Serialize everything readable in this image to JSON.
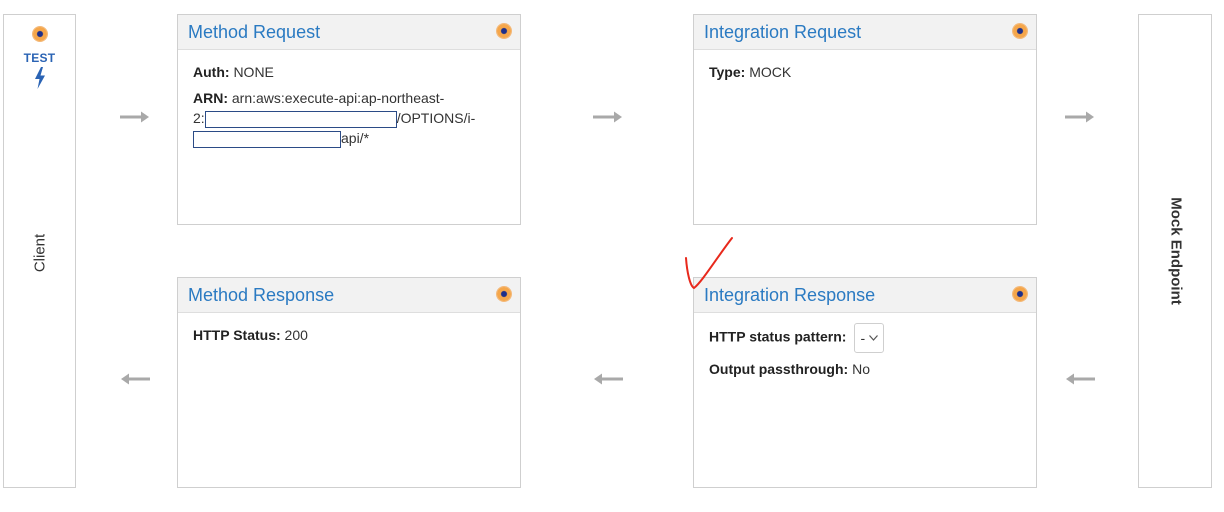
{
  "client": {
    "test_label": "TEST",
    "label": "Client"
  },
  "endpoint": {
    "label": "Mock Endpoint"
  },
  "method_request": {
    "title": "Method Request",
    "auth_label": "Auth:",
    "auth_value": "NONE",
    "arn_label": "ARN:",
    "arn_part1": "arn:aws:execute-api:ap-northeast-",
    "arn_part2": "2:",
    "arn_part3": "/OPTIONS/i-",
    "arn_part4": "api/*"
  },
  "integration_request": {
    "title": "Integration Request",
    "type_label": "Type:",
    "type_value": "MOCK"
  },
  "method_response": {
    "title": "Method Response",
    "status_label": "HTTP Status:",
    "status_value": "200"
  },
  "integration_response": {
    "title": "Integration Response",
    "pattern_label": "HTTP status pattern:",
    "pattern_value": "-",
    "passthrough_label": "Output passthrough:",
    "passthrough_value": "No"
  },
  "colors": {
    "title_blue": "#2a7ac2",
    "arrow_gray": "#a9a9a9",
    "annotation_red": "#e8291c"
  }
}
